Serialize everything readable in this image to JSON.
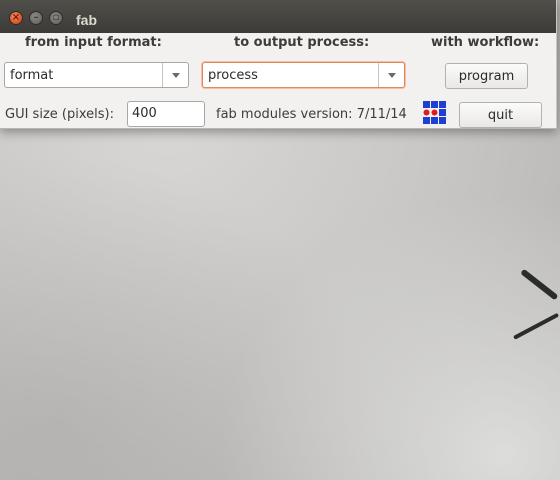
{
  "window": {
    "title": "fab",
    "controls": {
      "close_glyph": "×",
      "minimize_glyph": "–",
      "maximize_glyph": "▫"
    }
  },
  "headings": {
    "input": "from input format:",
    "output": "to output process:",
    "workflow": "with workflow:"
  },
  "input_format": {
    "value": "format"
  },
  "output_process": {
    "value": "process"
  },
  "workflow": {
    "button_label": "program"
  },
  "gui_size": {
    "label": "GUI size (pixels):",
    "value": "400"
  },
  "version": {
    "text": "fab modules version: 7/11/14"
  },
  "quit_button": {
    "label": "quit"
  },
  "colors": {
    "logo_blue": "#1f3fd0",
    "logo_red": "#e01b1b",
    "focus_accent": "#e28a55"
  },
  "icons": {
    "logo": "fab-modules-logo-icon",
    "dropdown": "chevron-down-icon"
  }
}
